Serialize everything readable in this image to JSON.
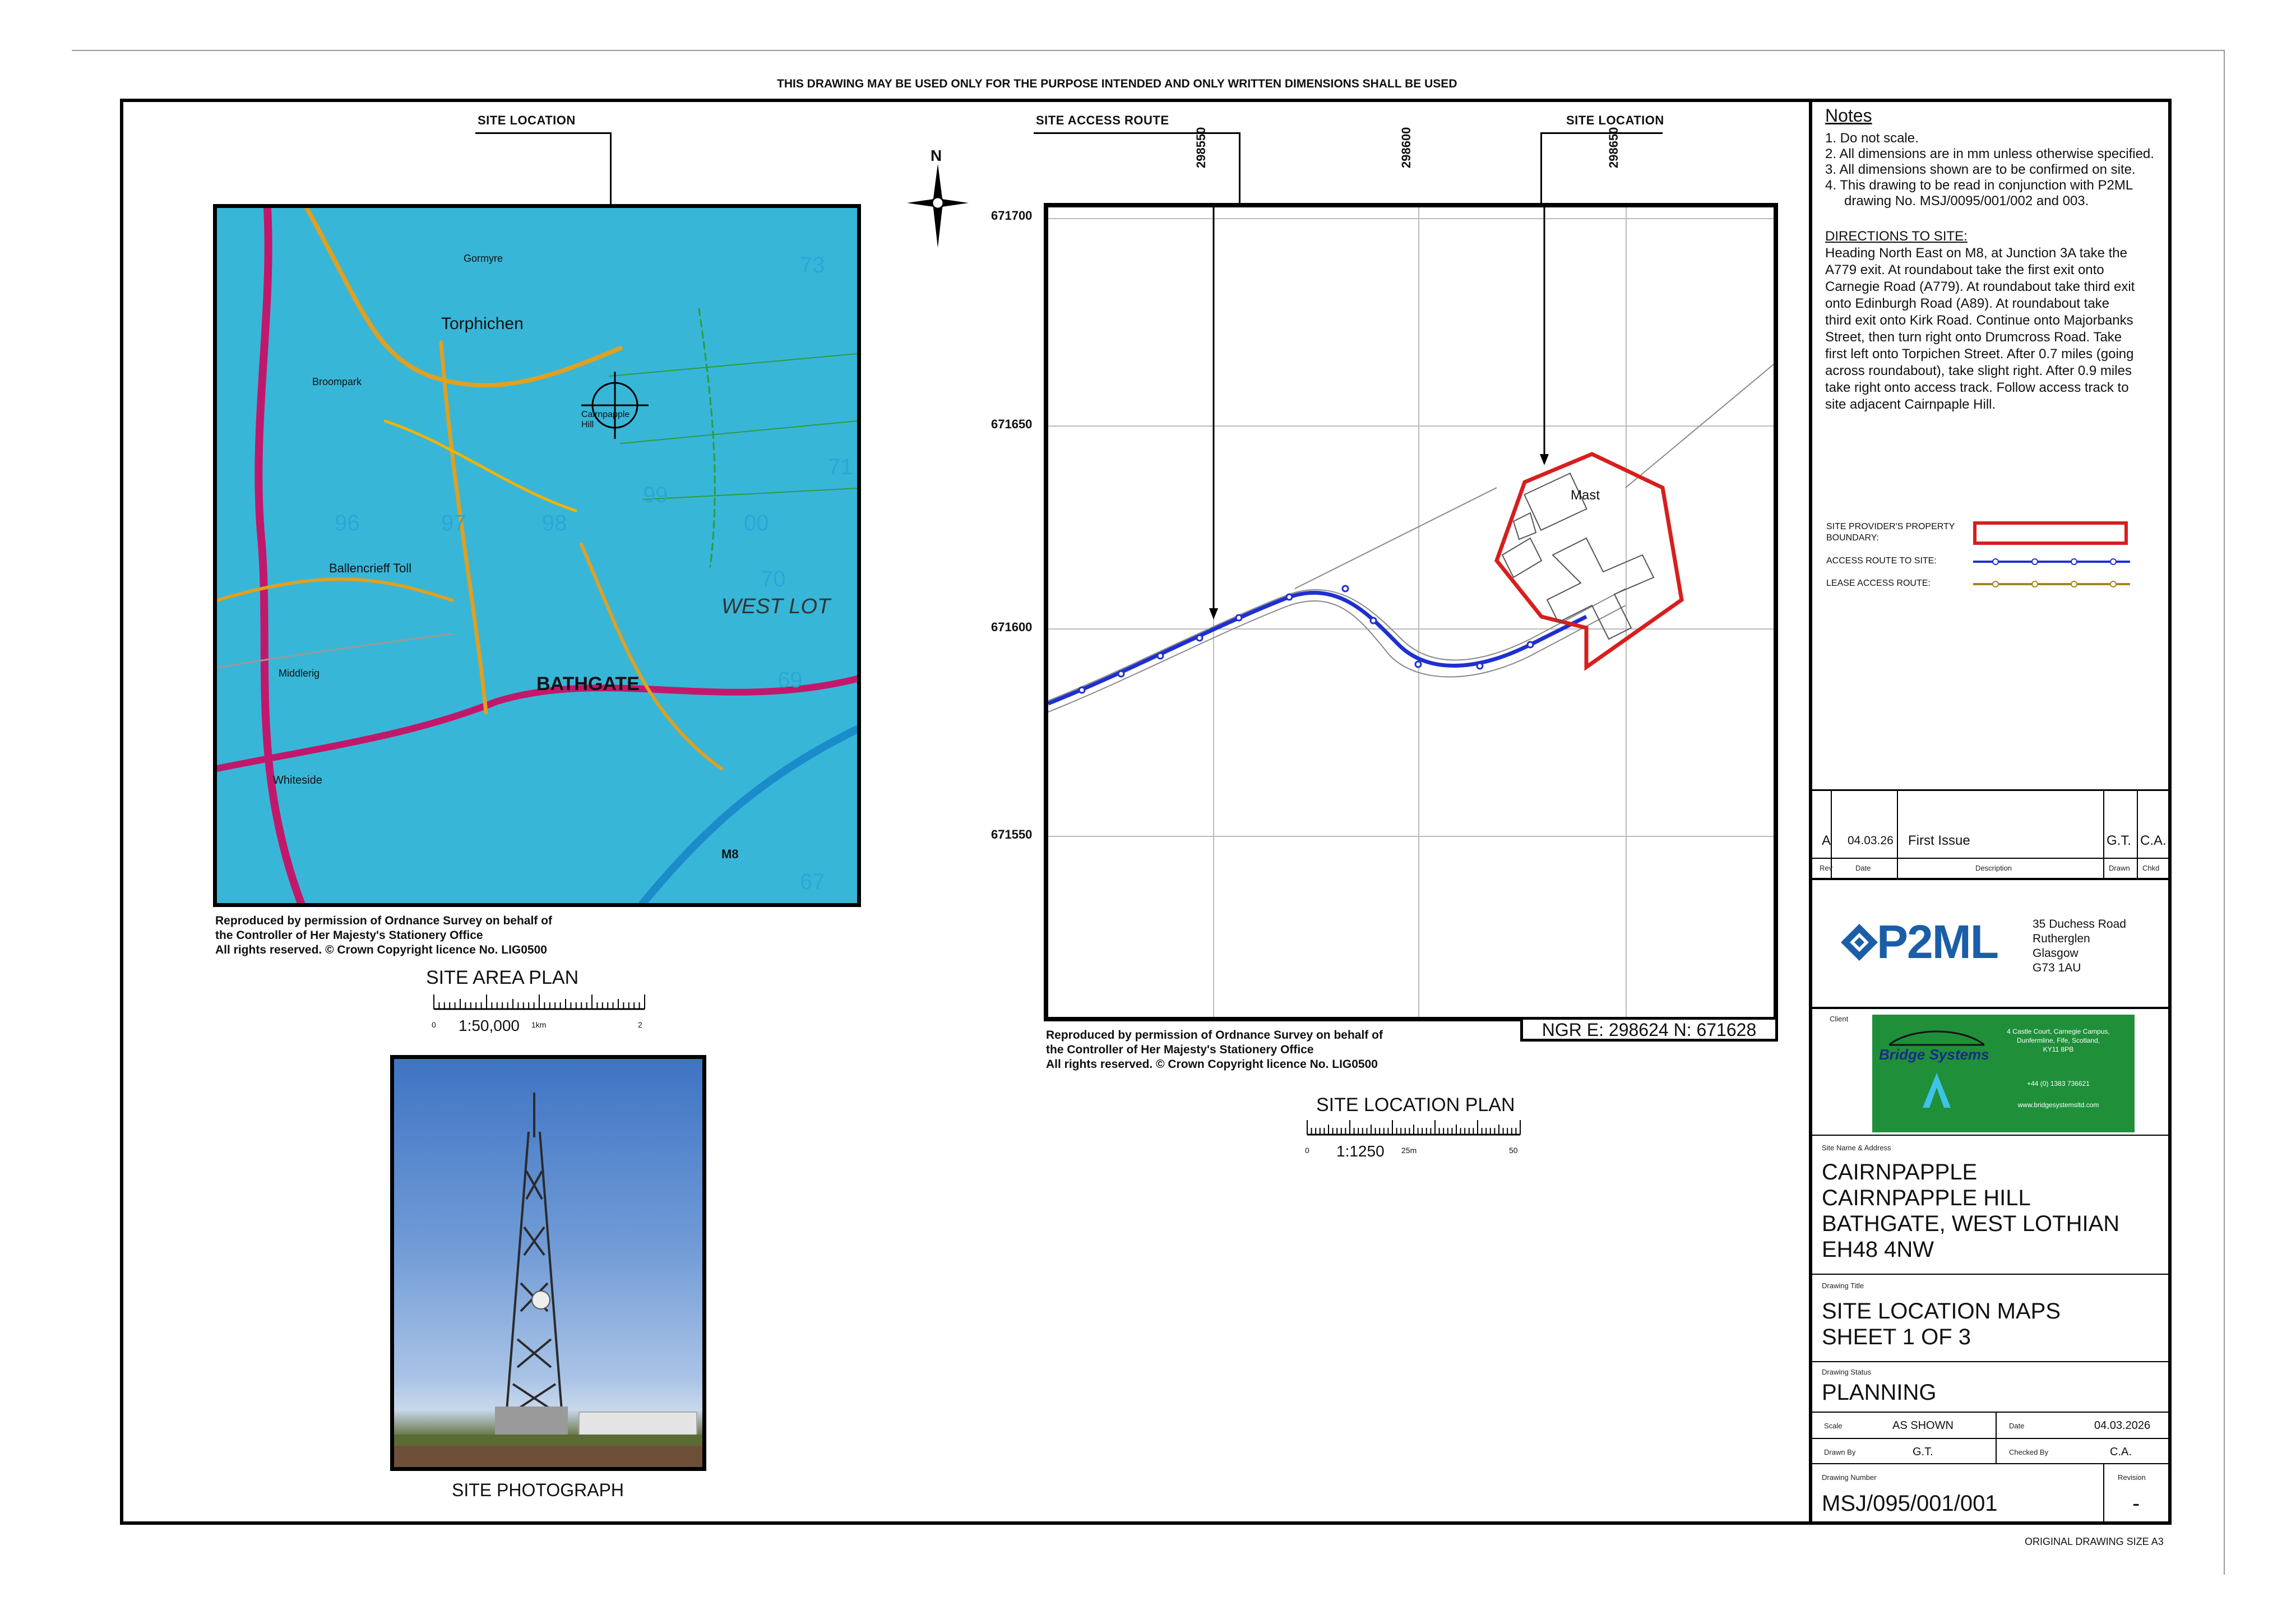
{
  "header": {
    "disclaimer": "THIS DRAWING MAY BE USED ONLY FOR THE PURPOSE INTENDED AND ONLY WRITTEN DIMENSIONS SHALL BE USED"
  },
  "area_plan": {
    "callout": "SITE LOCATION",
    "title": "SITE AREA PLAN",
    "scale_label": "1:50,000",
    "scale_ticks": [
      "0",
      "1km",
      "2"
    ],
    "copyright": [
      "Reproduced by permission of Ordnance Survey on behalf of",
      "the Controller of Her Majesty's Stationery Office",
      "All rights reserved. © Crown Copyright licence No. LIG0500"
    ],
    "map_labels": {
      "torphichen": "Torphichen",
      "bathgate": "BATHGATE",
      "west_lothian": "WEST LOT",
      "cairnpapple": "Cairnpapple Hill",
      "whiteside": "Whiteside",
      "ballencrieff": "Ballencrieff Toll",
      "middlerig": "Middlerig",
      "broompark": "Broompark",
      "gormyre": "Gormyre",
      "m8": "M8",
      "grid_96": "96",
      "grid_97": "97",
      "grid_98": "98",
      "grid_99": "99",
      "grid_00": "00",
      "grid_70": "70",
      "grid_69": "69",
      "grid_67": "67",
      "grid_73": "73",
      "grid_71": "71"
    }
  },
  "location_plan": {
    "north": "N",
    "callout_access": "SITE ACCESS ROUTE",
    "callout_site": "SITE LOCATION",
    "eastings": [
      "298550",
      "298600",
      "298650"
    ],
    "northings": [
      "671700",
      "671650",
      "671600",
      "671550"
    ],
    "mast_label": "Mast",
    "ngr": "NGR  E: 298624  N: 671628",
    "title": "SITE LOCATION PLAN",
    "scale_label": "1:1250",
    "scale_ticks": [
      "0",
      "25m",
      "50"
    ],
    "copyright": [
      "Reproduced by permission of Ordnance Survey on behalf of",
      "the Controller of Her Majesty's Stationery Office",
      "All rights reserved. © Crown Copyright licence No. LIG0500"
    ]
  },
  "photo": {
    "title": "SITE PHOTOGRAPH"
  },
  "notes": {
    "heading": "Notes",
    "items": [
      "1.  Do not scale.",
      "2.  All dimensions are in mm unless otherwise specified.",
      "3.  All dimensions shown are to be confirmed on site.",
      "4.  This drawing to be read in conjunction with P2ML drawing No. MSJ/0095/001/002 and 003."
    ],
    "directions_heading": "DIRECTIONS TO SITE:",
    "directions": "Heading North East on M8, at Junction 3A take the A779 exit. At roundabout take the first exit onto Carnegie Road (A779). At roundabout take third exit onto Edinburgh Road (A89). At roundabout take third exit onto Kirk Road. Continue onto Majorbanks Street, then turn right onto Drumcross Road. Take first left onto Torpichen Street. After 0.7 miles (going across roundabout), take slight right. After 0.9 miles take right onto access track. Follow access track to site adjacent Cairnpaple Hill."
  },
  "legend": {
    "boundary_label": "SITE PROVIDER'S PROPERTY BOUNDARY:",
    "access_label": "ACCESS ROUTE TO SITE:",
    "lease_label": "LEASE ACCESS ROUTE:",
    "boundary_color": "#d81e1e",
    "access_color": "#1f2fd0",
    "lease_color": "#a6861a"
  },
  "revision_table": {
    "row": {
      "rev": "A",
      "date": "04.03.26",
      "description": "First Issue",
      "drawn": "G.T.",
      "chkd": "C.A."
    },
    "headers": {
      "rev": "Rev",
      "date": "Date",
      "description": "Description",
      "drawn": "Drawn",
      "chkd": "Chkd"
    }
  },
  "company": {
    "logo_text": "P2ML",
    "address": [
      "35 Duchess Road",
      "Rutherglen",
      "Glasgow",
      "G73 1AU"
    ],
    "brand_color": "#1a5ea8"
  },
  "client": {
    "label": "Client",
    "name": "Bridge Systems",
    "address": [
      "4 Castle Court, Carnegie Campus,",
      "Dunfermline, Fife, Scotland,",
      "KY11 8PB"
    ],
    "phone": "+44 (0) 1383 736621",
    "web": "www.bridgesystemsltd.com",
    "card_color": "#1f8f3a"
  },
  "site": {
    "label": "Site Name & Address",
    "lines": [
      "CAIRNPAPPLE",
      "CAIRNPAPPLE HILL",
      "BATHGATE, WEST LOTHIAN",
      "EH48 4NW"
    ]
  },
  "drawing_title": {
    "label": "Drawing Title",
    "lines": [
      "SITE LOCATION MAPS",
      "SHEET 1 OF 3"
    ]
  },
  "drawing_status": {
    "label": "Drawing Status",
    "value": "PLANNING"
  },
  "meta": {
    "scale_label": "Scale",
    "scale_value": "AS SHOWN",
    "date_label": "Date",
    "date_value": "04.03.2026",
    "drawn_label": "Drawn By",
    "drawn_value": "G.T.",
    "checked_label": "Checked By",
    "checked_value": "C.A.",
    "number_label": "Drawing Number",
    "number_value": "MSJ/095/001/001",
    "revision_label": "Revision",
    "revision_value": "-"
  },
  "footer": {
    "original_size": "ORIGINAL DRAWING SIZE A3"
  }
}
